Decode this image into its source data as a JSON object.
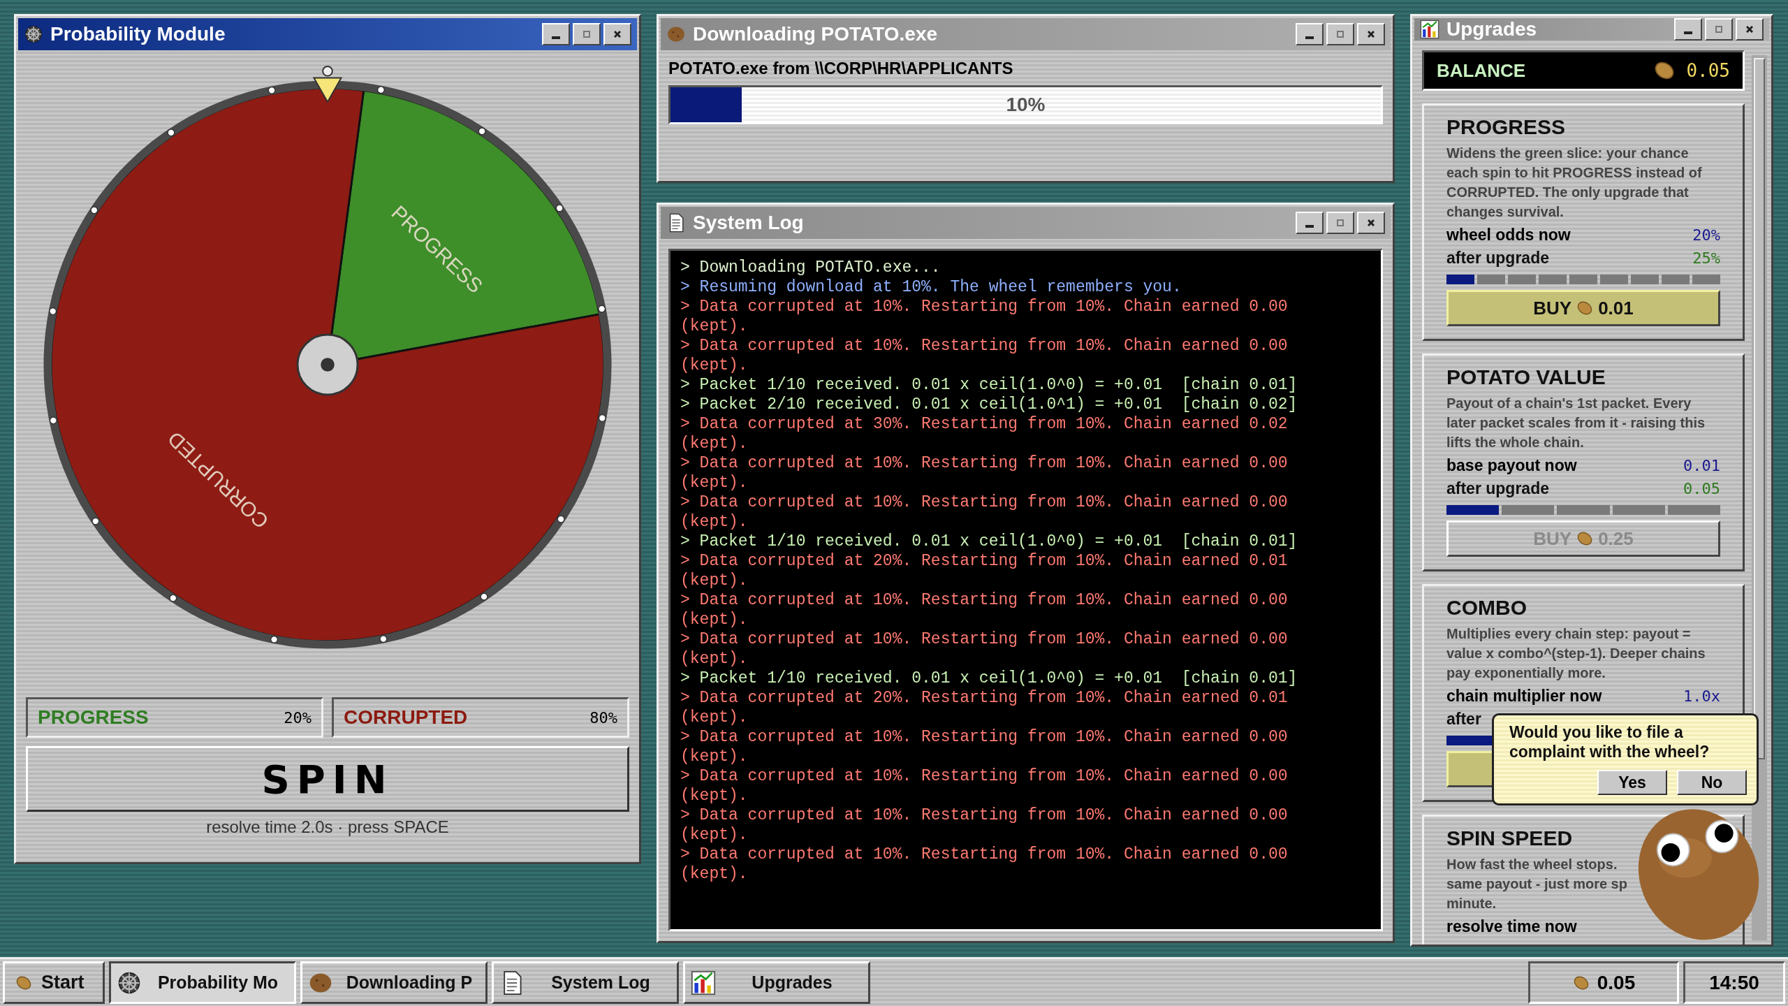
{
  "probability_window": {
    "title": "Probability Module",
    "active": true,
    "wheel": {
      "chart_data": {
        "type": "pie",
        "categories": [
          "PROGRESS",
          "CORRUPTED"
        ],
        "values": [
          20,
          80
        ]
      }
    },
    "legend": [
      {
        "label": "PROGRESS",
        "value": "20%",
        "color": "#2f7d22"
      },
      {
        "label": "CORRUPTED",
        "value": "80%",
        "color": "#8c1a10"
      }
    ],
    "spin_button": "SPIN",
    "hint": "resolve time 2.0s · press SPACE"
  },
  "download_window": {
    "title": "Downloading POTATO.exe",
    "active": false,
    "source": "POTATO.exe from \\\\CORP\\HR\\APPLICANTS",
    "progress": {
      "level": 0.1,
      "reading": "10%"
    }
  },
  "log_window": {
    "title": "System Log",
    "active": false,
    "lines": [
      {
        "kind": "info",
        "text": "> Downloading POTATO.exe..."
      },
      {
        "kind": "notice",
        "text": "> Resuming download at 10%. The wheel remembers you."
      },
      {
        "kind": "error",
        "text": "> Data corrupted at 10%. Restarting from 10%. Chain earned 0.00 (kept)."
      },
      {
        "kind": "error",
        "text": "> Data corrupted at 10%. Restarting from 10%. Chain earned 0.00 (kept)."
      },
      {
        "kind": "packet",
        "text": "> Packet 1/10 received. 0.01 x ceil(1.0^0) = +0.01  [chain 0.01]"
      },
      {
        "kind": "packet",
        "text": "> Packet 2/10 received. 0.01 x ceil(1.0^1) = +0.01  [chain 0.02]"
      },
      {
        "kind": "error",
        "text": "> Data corrupted at 30%. Restarting from 10%. Chain earned 0.02 (kept)."
      },
      {
        "kind": "error",
        "text": "> Data corrupted at 10%. Restarting from 10%. Chain earned 0.00 (kept)."
      },
      {
        "kind": "error",
        "text": "> Data corrupted at 10%. Restarting from 10%. Chain earned 0.00 (kept)."
      },
      {
        "kind": "packet",
        "text": "> Packet 1/10 received. 0.01 x ceil(1.0^0) = +0.01  [chain 0.01]"
      },
      {
        "kind": "error",
        "text": "> Data corrupted at 20%. Restarting from 10%. Chain earned 0.01 (kept)."
      },
      {
        "kind": "error",
        "text": "> Data corrupted at 10%. Restarting from 10%. Chain earned 0.00 (kept)."
      },
      {
        "kind": "error",
        "text": "> Data corrupted at 10%. Restarting from 10%. Chain earned 0.00 (kept)."
      },
      {
        "kind": "packet",
        "text": "> Packet 1/10 received. 0.01 x ceil(1.0^0) = +0.01  [chain 0.01]"
      },
      {
        "kind": "error",
        "text": "> Data corrupted at 20%. Restarting from 10%. Chain earned 0.01 (kept)."
      },
      {
        "kind": "error",
        "text": "> Data corrupted at 10%. Restarting from 10%. Chain earned 0.00 (kept)."
      },
      {
        "kind": "error",
        "text": "> Data corrupted at 10%. Restarting from 10%. Chain earned 0.00 (kept)."
      },
      {
        "kind": "error",
        "text": "> Data corrupted at 10%. Restarting from 10%. Chain earned 0.00 (kept)."
      },
      {
        "kind": "error",
        "text": "> Data corrupted at 10%. Restarting from 10%. Chain earned 0.00 (kept)."
      }
    ]
  },
  "upgrades_window": {
    "title": "Upgrades",
    "active": false,
    "balance": {
      "label": "BALANCE",
      "value": "0.05"
    },
    "cards": [
      {
        "title": "PROGRESS",
        "description": "Widens the green slice: your chance each spin to hit PROGRESS instead of CORRUPTED. The only upgrade that changes survival.",
        "stats": [
          {
            "label": "wheel odds now",
            "value": "20%",
            "kind": "now"
          },
          {
            "label": "after upgrade",
            "value": "25%",
            "kind": "after"
          }
        ],
        "steps": [
          {
            "filled": true
          },
          {
            "filled": false
          },
          {
            "filled": false
          },
          {
            "filled": false
          },
          {
            "filled": false
          },
          {
            "filled": false
          },
          {
            "filled": false
          },
          {
            "filled": false
          },
          {
            "filled": false
          }
        ],
        "buy": {
          "label": "BUY",
          "price": "0.01",
          "disabled": false
        }
      },
      {
        "title": "POTATO VALUE",
        "description": "Payout of a chain's 1st packet. Every later packet scales from it - raising this lifts the whole chain.",
        "stats": [
          {
            "label": "base payout now",
            "value": "0.01",
            "kind": "now"
          },
          {
            "label": "after upgrade",
            "value": "0.05",
            "kind": "after"
          }
        ],
        "steps": [
          {
            "filled": true
          },
          {
            "filled": false
          },
          {
            "filled": false
          },
          {
            "filled": false
          },
          {
            "filled": false
          }
        ],
        "buy": {
          "label": "BUY",
          "price": "0.25",
          "disabled": true
        }
      },
      {
        "title": "COMBO",
        "description": "Multiplies every chain step: payout = value x combo^(step-1). Deeper chains pay exponentially more.",
        "stats": [
          {
            "label": "chain multiplier now",
            "value": "1.0x",
            "kind": "now"
          },
          {
            "label": "after",
            "kind": "after"
          }
        ],
        "steps": [
          {
            "filled": true
          }
        ],
        "buy": {
          "disabled": false
        }
      },
      {
        "title": "SPIN SPEED",
        "lines": [
          "How fast the wheel stops.",
          "same payout - just more sp",
          "minute."
        ],
        "stats": [
          {
            "label": "resolve time now",
            "kind": "now"
          }
        ]
      }
    ],
    "dialog": {
      "text": "Would you like to file a complaint with the wheel?",
      "buttons": [
        "Yes",
        "No"
      ]
    }
  },
  "taskbar": {
    "start": "Start",
    "tasks": [
      {
        "label": "Probability Mo",
        "kind": "wheel",
        "selected": true
      },
      {
        "label": "Downloading P",
        "kind": "potato",
        "selected": false
      },
      {
        "label": "System Log",
        "kind": "document",
        "selected": false
      },
      {
        "label": "Upgrades",
        "kind": "chart",
        "selected": false
      }
    ],
    "balance": "0.05",
    "clock": "14:50"
  }
}
